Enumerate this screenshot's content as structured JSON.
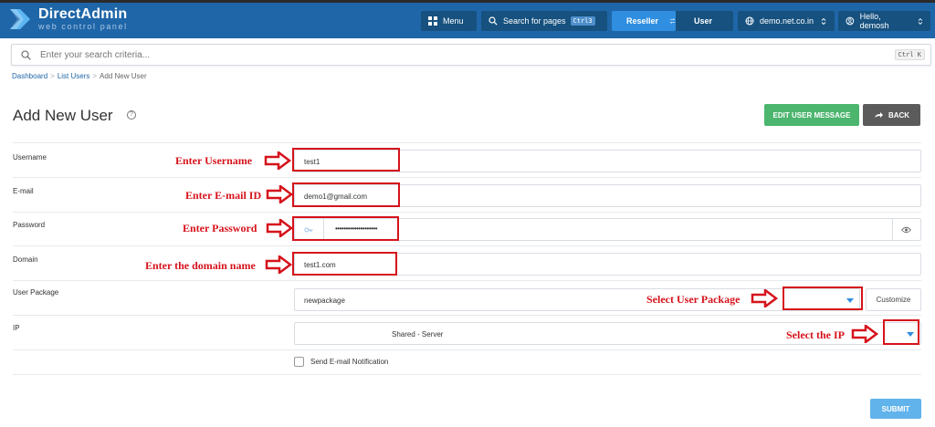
{
  "header": {
    "logo_title": "DirectAdmin",
    "logo_subtitle": "web control panel",
    "menu_label": "Menu",
    "search_pages_label": "Search for pages",
    "search_pages_shortcut": "Ctrl3",
    "reseller_label": "Reseller",
    "user_label": "User",
    "domain_label": "demo.net.co.in",
    "hello_label": "Hello, demosh"
  },
  "search": {
    "placeholder": "Enter your search criteria...",
    "shortcut": "Ctrl K"
  },
  "breadcrumb": {
    "items": [
      "Dashboard",
      "List Users",
      "Add New User"
    ]
  },
  "page": {
    "title": "Add New User",
    "edit_message_label": "EDIT USER MESSAGE",
    "back_label": "BACK"
  },
  "form": {
    "username_label": "Username",
    "username_value": "test1",
    "email_label": "E-mail",
    "email_value": "demo1@gmail.com",
    "password_label": "Password",
    "password_value": "••••••••••••••••••••",
    "domain_label": "Domain",
    "domain_value": "test1.com",
    "package_label": "User Package",
    "package_value": "newpackage",
    "customize_label": "Customize",
    "ip_label": "IP",
    "ip_value": "Shared - Server",
    "notify_label": "Send E-mail Notification",
    "submit_label": "SUBMIT"
  },
  "annotations": {
    "username": "Enter Username",
    "email": "Enter E-mail ID",
    "password": "Enter Password",
    "domain": "Enter the domain name",
    "package": "Select User Package",
    "ip": "Select the IP"
  },
  "colors": {
    "topbar": "#1f66a8",
    "annotation_red": "#d6131b",
    "green_button": "#4cb56e",
    "submit_button": "#61b3ec",
    "reseller_active": "#2f8ee0"
  },
  "icons": [
    "directadmin-logo-icon",
    "menu-grid-icon",
    "search-icon",
    "swap-icon",
    "globe-icon",
    "user-circle-icon",
    "chevron-updown-icon",
    "help-icon",
    "share-arrow-icon",
    "key-icon",
    "eye-icon",
    "dropdown-caret-icon"
  ]
}
